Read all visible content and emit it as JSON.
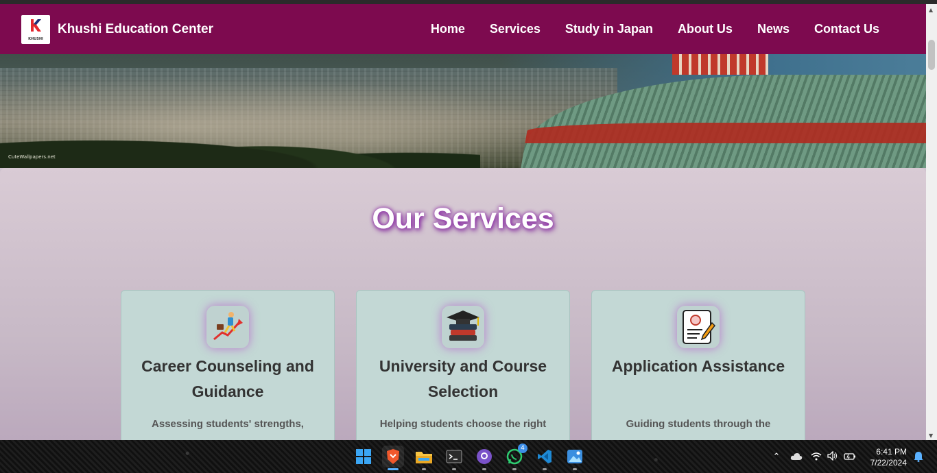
{
  "site": {
    "logo_text": "KHUSHI",
    "brand_name": "Khushi Education Center",
    "nav": [
      {
        "label": "Home"
      },
      {
        "label": "Services"
      },
      {
        "label": "Study in Japan"
      },
      {
        "label": "About Us"
      },
      {
        "label": "News"
      },
      {
        "label": "Contact Us"
      }
    ],
    "hero_watermark": "CuteWallpapers.net"
  },
  "services": {
    "title": "Our Services",
    "cards": [
      {
        "icon": "career-climb-icon",
        "title": "Career Counseling and Guidance",
        "text": "Assessing students' strengths,"
      },
      {
        "icon": "graduation-books-icon",
        "title": "University and Course Selection",
        "text": "Helping students choose the right"
      },
      {
        "icon": "application-form-icon",
        "title": "Application Assistance",
        "text": "Guiding students through the"
      }
    ]
  },
  "taskbar": {
    "apps": [
      {
        "icon": "windows-start-icon"
      },
      {
        "icon": "brave-browser-icon"
      },
      {
        "icon": "file-explorer-icon"
      },
      {
        "icon": "terminal-icon"
      },
      {
        "icon": "github-icon"
      },
      {
        "icon": "whatsapp-icon",
        "badge": "4"
      },
      {
        "icon": "vscode-icon"
      },
      {
        "icon": "photos-icon"
      }
    ],
    "time": "6:41 PM",
    "date": "7/22/2024"
  },
  "colors": {
    "header_bg": "#7d0a4f",
    "card_bg": "#c3d8d5",
    "title_glow": "#8e2aa8"
  }
}
